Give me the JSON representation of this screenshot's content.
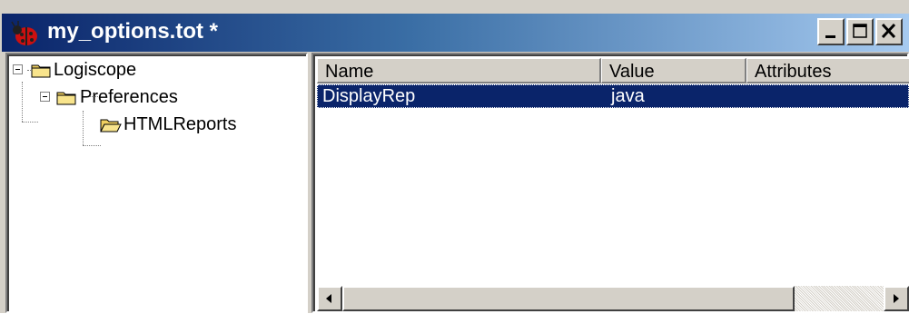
{
  "window": {
    "title": "my_options.tot *",
    "app_icon": "ladybug-app-icon",
    "controls": [
      "minimize-icon",
      "maximize-icon",
      "close-icon"
    ]
  },
  "tree": {
    "nodes": [
      {
        "label": "Logiscope",
        "level": 0,
        "expanded": true,
        "icon": "folder-icon"
      },
      {
        "label": "Preferences",
        "level": 1,
        "expanded": true,
        "icon": "folder-icon"
      },
      {
        "label": "HTMLReports",
        "level": 2,
        "expanded": true,
        "icon": "folder-open-icon"
      }
    ]
  },
  "list": {
    "columns": [
      "Name",
      "Value",
      "Attributes"
    ],
    "rows": [
      {
        "name": "DisplayRep",
        "value": "java",
        "attributes": "",
        "selected": true
      }
    ]
  },
  "colors": {
    "title_gradient_start": "#0a246a",
    "title_gradient_end": "#a6caf0",
    "selection": "#0a246a",
    "face": "#d4d0c8"
  }
}
